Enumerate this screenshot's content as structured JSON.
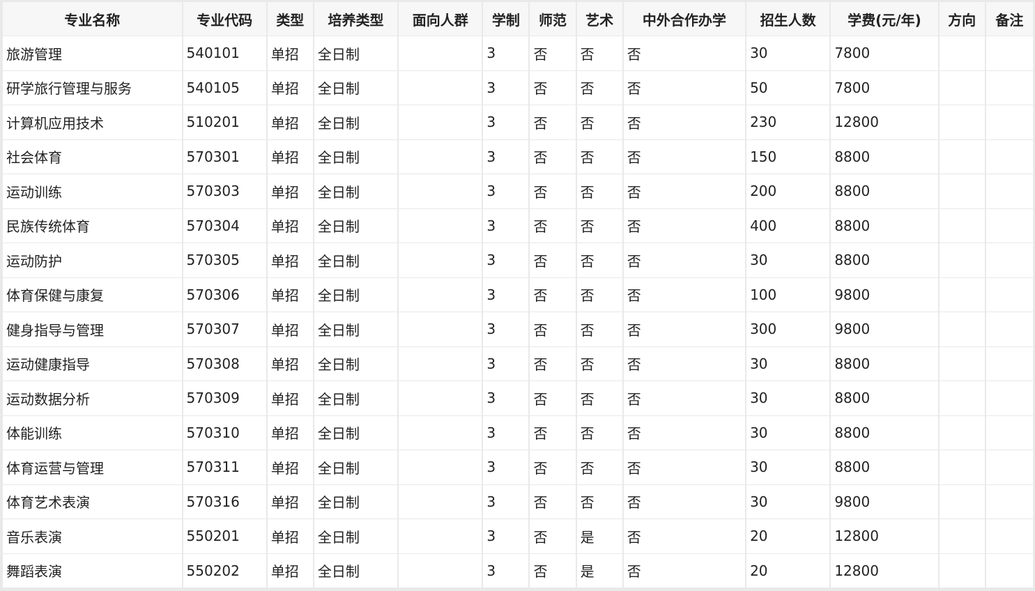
{
  "table": {
    "columns": [
      "专业名称",
      "专业代码",
      "类型",
      "培养类型",
      "面向人群",
      "学制",
      "师范",
      "艺术",
      "中外合作办学",
      "招生人数",
      "学费(元/年)",
      "方向",
      "备注"
    ],
    "rows": [
      [
        "旅游管理",
        "540101",
        "单招",
        "全日制",
        "",
        "3",
        "否",
        "否",
        "否",
        "30",
        "7800",
        "",
        ""
      ],
      [
        "研学旅行管理与服务",
        "540105",
        "单招",
        "全日制",
        "",
        "3",
        "否",
        "否",
        "否",
        "50",
        "7800",
        "",
        ""
      ],
      [
        "计算机应用技术",
        "510201",
        "单招",
        "全日制",
        "",
        "3",
        "否",
        "否",
        "否",
        "230",
        "12800",
        "",
        ""
      ],
      [
        "社会体育",
        "570301",
        "单招",
        "全日制",
        "",
        "3",
        "否",
        "否",
        "否",
        "150",
        "8800",
        "",
        ""
      ],
      [
        "运动训练",
        "570303",
        "单招",
        "全日制",
        "",
        "3",
        "否",
        "否",
        "否",
        "200",
        "8800",
        "",
        ""
      ],
      [
        "民族传统体育",
        "570304",
        "单招",
        "全日制",
        "",
        "3",
        "否",
        "否",
        "否",
        "400",
        "8800",
        "",
        ""
      ],
      [
        "运动防护",
        "570305",
        "单招",
        "全日制",
        "",
        "3",
        "否",
        "否",
        "否",
        "30",
        "8800",
        "",
        ""
      ],
      [
        "体育保健与康复",
        "570306",
        "单招",
        "全日制",
        "",
        "3",
        "否",
        "否",
        "否",
        "100",
        "9800",
        "",
        ""
      ],
      [
        "健身指导与管理",
        "570307",
        "单招",
        "全日制",
        "",
        "3",
        "否",
        "否",
        "否",
        "300",
        "9800",
        "",
        ""
      ],
      [
        "运动健康指导",
        "570308",
        "单招",
        "全日制",
        "",
        "3",
        "否",
        "否",
        "否",
        "30",
        "8800",
        "",
        ""
      ],
      [
        "运动数据分析",
        "570309",
        "单招",
        "全日制",
        "",
        "3",
        "否",
        "否",
        "否",
        "30",
        "8800",
        "",
        ""
      ],
      [
        "体能训练",
        "570310",
        "单招",
        "全日制",
        "",
        "3",
        "否",
        "否",
        "否",
        "30",
        "8800",
        "",
        ""
      ],
      [
        "体育运营与管理",
        "570311",
        "单招",
        "全日制",
        "",
        "3",
        "否",
        "否",
        "否",
        "30",
        "8800",
        "",
        ""
      ],
      [
        "体育艺术表演",
        "570316",
        "单招",
        "全日制",
        "",
        "3",
        "否",
        "否",
        "否",
        "30",
        "9800",
        "",
        ""
      ],
      [
        "音乐表演",
        "550201",
        "单招",
        "全日制",
        "",
        "3",
        "否",
        "是",
        "否",
        "20",
        "12800",
        "",
        ""
      ],
      [
        "舞蹈表演",
        "550202",
        "单招",
        "全日制",
        "",
        "3",
        "否",
        "是",
        "否",
        "20",
        "12800",
        "",
        ""
      ]
    ]
  }
}
